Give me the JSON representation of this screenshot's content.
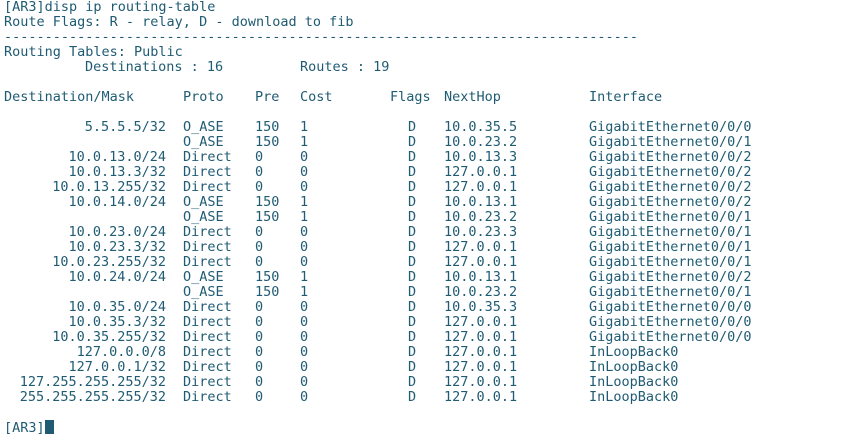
{
  "terminal": {
    "command_line": "[AR3]disp ip routing-table",
    "flags_line": "Route Flags: R - relay, D - download to fib",
    "rule": "------------------------------------------------------------------------------",
    "tables_line": "Routing Tables: Public",
    "destinations_label": "Destinations : 16",
    "routes_label": "Routes : 19",
    "prompt": "[AR3]"
  },
  "table": {
    "headers": {
      "dest": "Destination/Mask",
      "proto": "Proto",
      "pre": "Pre",
      "cost": "Cost",
      "flags": "Flags",
      "nexthop": "NextHop",
      "iface": "Interface"
    },
    "rows": [
      {
        "dest": "5.5.5.5/32",
        "proto": "O_ASE",
        "pre": "150",
        "cost": "1",
        "flags": "D",
        "nexthop": "10.0.35.5",
        "iface": "GigabitEthernet0/0/0"
      },
      {
        "dest": "",
        "proto": "O_ASE",
        "pre": "150",
        "cost": "1",
        "flags": "D",
        "nexthop": "10.0.23.2",
        "iface": "GigabitEthernet0/0/1"
      },
      {
        "dest": "10.0.13.0/24",
        "proto": "Direct",
        "pre": "0",
        "cost": "0",
        "flags": "D",
        "nexthop": "10.0.13.3",
        "iface": "GigabitEthernet0/0/2"
      },
      {
        "dest": "10.0.13.3/32",
        "proto": "Direct",
        "pre": "0",
        "cost": "0",
        "flags": "D",
        "nexthop": "127.0.0.1",
        "iface": "GigabitEthernet0/0/2"
      },
      {
        "dest": "10.0.13.255/32",
        "proto": "Direct",
        "pre": "0",
        "cost": "0",
        "flags": "D",
        "nexthop": "127.0.0.1",
        "iface": "GigabitEthernet0/0/2"
      },
      {
        "dest": "10.0.14.0/24",
        "proto": "O_ASE",
        "pre": "150",
        "cost": "1",
        "flags": "D",
        "nexthop": "10.0.13.1",
        "iface": "GigabitEthernet0/0/2"
      },
      {
        "dest": "",
        "proto": "O_ASE",
        "pre": "150",
        "cost": "1",
        "flags": "D",
        "nexthop": "10.0.23.2",
        "iface": "GigabitEthernet0/0/1"
      },
      {
        "dest": "10.0.23.0/24",
        "proto": "Direct",
        "pre": "0",
        "cost": "0",
        "flags": "D",
        "nexthop": "10.0.23.3",
        "iface": "GigabitEthernet0/0/1"
      },
      {
        "dest": "10.0.23.3/32",
        "proto": "Direct",
        "pre": "0",
        "cost": "0",
        "flags": "D",
        "nexthop": "127.0.0.1",
        "iface": "GigabitEthernet0/0/1"
      },
      {
        "dest": "10.0.23.255/32",
        "proto": "Direct",
        "pre": "0",
        "cost": "0",
        "flags": "D",
        "nexthop": "127.0.0.1",
        "iface": "GigabitEthernet0/0/1"
      },
      {
        "dest": "10.0.24.0/24",
        "proto": "O_ASE",
        "pre": "150",
        "cost": "1",
        "flags": "D",
        "nexthop": "10.0.13.1",
        "iface": "GigabitEthernet0/0/2"
      },
      {
        "dest": "",
        "proto": "O_ASE",
        "pre": "150",
        "cost": "1",
        "flags": "D",
        "nexthop": "10.0.23.2",
        "iface": "GigabitEthernet0/0/1"
      },
      {
        "dest": "10.0.35.0/24",
        "proto": "Direct",
        "pre": "0",
        "cost": "0",
        "flags": "D",
        "nexthop": "10.0.35.3",
        "iface": "GigabitEthernet0/0/0"
      },
      {
        "dest": "10.0.35.3/32",
        "proto": "Direct",
        "pre": "0",
        "cost": "0",
        "flags": "D",
        "nexthop": "127.0.0.1",
        "iface": "GigabitEthernet0/0/0"
      },
      {
        "dest": "10.0.35.255/32",
        "proto": "Direct",
        "pre": "0",
        "cost": "0",
        "flags": "D",
        "nexthop": "127.0.0.1",
        "iface": "GigabitEthernet0/0/0"
      },
      {
        "dest": "127.0.0.0/8",
        "proto": "Direct",
        "pre": "0",
        "cost": "0",
        "flags": "D",
        "nexthop": "127.0.0.1",
        "iface": "InLoopBack0"
      },
      {
        "dest": "127.0.0.1/32",
        "proto": "Direct",
        "pre": "0",
        "cost": "0",
        "flags": "D",
        "nexthop": "127.0.0.1",
        "iface": "InLoopBack0"
      },
      {
        "dest": "127.255.255.255/32",
        "proto": "Direct",
        "pre": "0",
        "cost": "0",
        "flags": "D",
        "nexthop": "127.0.0.1",
        "iface": "InLoopBack0"
      },
      {
        "dest": "255.255.255.255/32",
        "proto": "Direct",
        "pre": "0",
        "cost": "0",
        "flags": "D",
        "nexthop": "127.0.0.1",
        "iface": "InLoopBack0"
      }
    ]
  }
}
